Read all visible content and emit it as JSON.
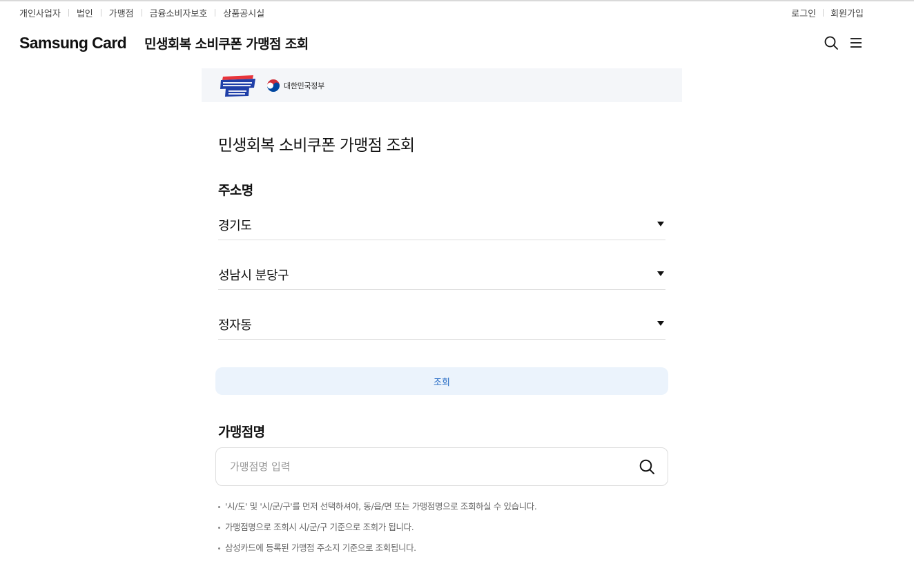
{
  "util_nav": {
    "items": [
      "개인사업자",
      "법인",
      "가맹점",
      "금융소비자보호",
      "상품공시실"
    ]
  },
  "account": {
    "login": "로그인",
    "signup": "회원가입"
  },
  "header": {
    "brand": "Samsung Card",
    "title": "민생회복 소비쿠폰 가맹점 조회",
    "icons": [
      "search-icon",
      "menu-icon"
    ]
  },
  "banner": {
    "campaign_logo": "회복과 성장의 마중물",
    "gov_label": "대한민국정부"
  },
  "main": {
    "page_title": "민생회복 소비쿠폰 가맹점 조회",
    "address_label": "주소명",
    "selects": {
      "province": "경기도",
      "city": "성남시 분당구",
      "district": "정자동"
    },
    "search_button": "조회",
    "merchant_label": "가맹점명",
    "merchant_placeholder": "가맹점명 입력",
    "notes": [
      "'시/도' 및 '시/군/구'를 먼저 선택하셔야, 동/읍/면 또는 가맹점명으로 조회하실 수 있습니다.",
      "가맹점명으로 조회시 시/군/구 기준으로 조회가 됩니다.",
      "삼성카드에 등록된 가맹점 주소지 기준으로 조회됩니다."
    ]
  },
  "colors": {
    "button_bg": "#ebf3fc",
    "button_text": "#1761c0",
    "banner_bg": "#f4f6f9"
  }
}
